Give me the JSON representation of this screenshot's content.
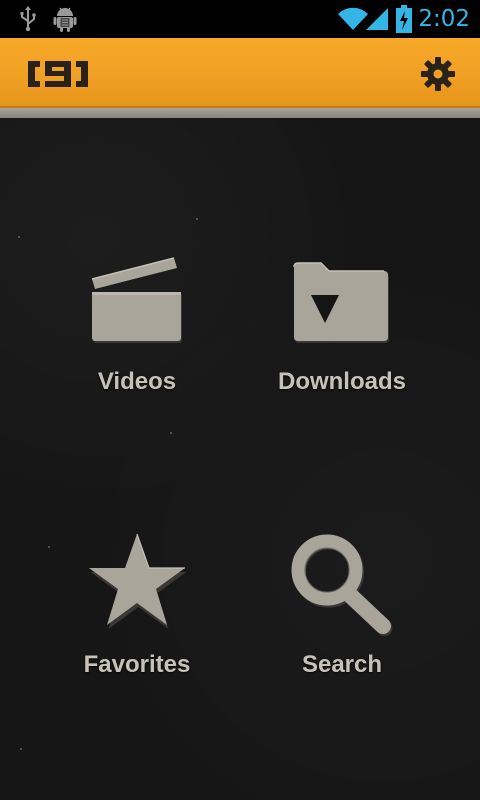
{
  "status_bar": {
    "time": "2:02",
    "icons": [
      "usb-icon",
      "android-debug-icon",
      "wifi-icon",
      "signal-icon",
      "battery-charging-icon"
    ],
    "accent_color": "#33b5e5"
  },
  "action_bar": {
    "logo_text": "[9]",
    "settings_icon": "gear-icon",
    "background_color": "#f0a024"
  },
  "menu": {
    "items": [
      {
        "label": "Videos",
        "icon": "clapperboard-icon"
      },
      {
        "label": "Downloads",
        "icon": "download-folder-icon"
      },
      {
        "label": "Favorites",
        "icon": "star-icon"
      },
      {
        "label": "Search",
        "icon": "magnifier-icon"
      }
    ],
    "icon_color": "#aaa59b",
    "label_color": "#c7c2b8"
  }
}
